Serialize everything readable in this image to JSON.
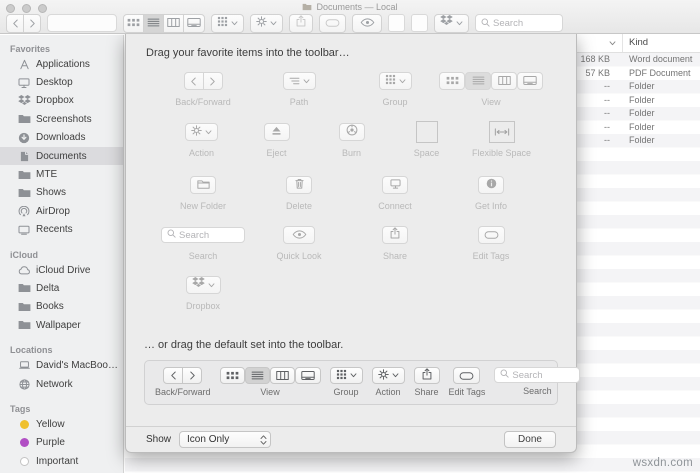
{
  "window": {
    "title": "Documents — Local",
    "watermark": "wsxdn.com"
  },
  "icons": {
    "proxy": "folder-small",
    "back": "chevron-left",
    "forward": "chevron-right",
    "dropdown": "chevron-down",
    "stepper": "chevron-updown",
    "sort": "chevron-down",
    "view_icon": "icon-view",
    "view_list": "list-view",
    "view_column": "column-view",
    "view_coverflow": "coverflow-view",
    "group": "grid-group",
    "action": "gear",
    "share": "share-arrow",
    "edit_tags": "tag-oval",
    "quick_look": "eye",
    "dropbox": "dropbox-box",
    "search": "magnifier",
    "path": "path-lines",
    "eject": "eject",
    "burn": "burn-disc",
    "flexible_space": "double-arrow",
    "new_folder": "folder-new",
    "delete": "trash",
    "connect": "monitor",
    "get_info": "info-circle"
  },
  "toolbar": {
    "search_placeholder": "Search"
  },
  "sidebar": {
    "sections": [
      {
        "title": "Favorites",
        "items": [
          {
            "label": "Applications",
            "icon": "apps"
          },
          {
            "label": "Desktop",
            "icon": "desktop-mon"
          },
          {
            "label": "Dropbox",
            "icon": "dropbox-box"
          },
          {
            "label": "Screenshots",
            "icon": "folder-fill"
          },
          {
            "label": "Downloads",
            "icon": "download-circle"
          },
          {
            "label": "Documents",
            "icon": "doc-page",
            "selected": true
          },
          {
            "label": "MTE",
            "icon": "folder-fill"
          },
          {
            "label": "Shows",
            "icon": "folder-fill"
          },
          {
            "label": "AirDrop",
            "icon": "airdrop"
          },
          {
            "label": "Recents",
            "icon": "display"
          }
        ]
      },
      {
        "title": "iCloud",
        "items": [
          {
            "label": "iCloud Drive",
            "icon": "cloud"
          },
          {
            "label": "Delta",
            "icon": "folder-fill"
          },
          {
            "label": "Books",
            "icon": "folder-fill"
          },
          {
            "label": "Wallpaper",
            "icon": "folder-fill"
          }
        ]
      },
      {
        "title": "Locations",
        "items": [
          {
            "label": "David's MacBoo…",
            "icon": "laptop"
          },
          {
            "label": "Network",
            "icon": "globe"
          }
        ]
      },
      {
        "title": "Tags",
        "items": [
          {
            "label": "Yellow",
            "dot": "#efc02e"
          },
          {
            "label": "Purple",
            "dot": "#b14fc4"
          },
          {
            "label": "Important",
            "dot": "#ffffff"
          }
        ]
      }
    ]
  },
  "file_list": {
    "kind_header": "Kind",
    "rows": [
      {
        "size": "168 KB",
        "kind": "Word document"
      },
      {
        "size": "57 KB",
        "kind": "PDF Document"
      },
      {
        "size": "--",
        "kind": "Folder"
      },
      {
        "size": "--",
        "kind": "Folder"
      },
      {
        "size": "--",
        "kind": "Folder"
      },
      {
        "size": "--",
        "kind": "Folder"
      },
      {
        "size": "--",
        "kind": "Folder"
      }
    ]
  },
  "sheet": {
    "drag_text": "Drag your favorite items into the toolbar…",
    "labels": {
      "back_forward": "Back/Forward",
      "path": "Path",
      "group": "Group",
      "view": "View",
      "action": "Action",
      "eject": "Eject",
      "burn": "Burn",
      "space": "Space",
      "flexible_space": "Flexible Space",
      "new_folder": "New Folder",
      "delete": "Delete",
      "connect": "Connect",
      "get_info": "Get Info",
      "search": "Search",
      "quick_look": "Quick Look",
      "share": "Share",
      "edit_tags": "Edit Tags",
      "dropbox": "Dropbox"
    },
    "search_placeholder": "Search",
    "default_text": "… or drag the default set into the toolbar.",
    "default_labels": {
      "back_forward": "Back/Forward",
      "view": "View",
      "group": "Group",
      "action": "Action",
      "share": "Share",
      "edit_tags": "Edit Tags",
      "search": "Search"
    },
    "show_label": "Show",
    "show_value": "Icon Only",
    "done_label": "Done"
  }
}
